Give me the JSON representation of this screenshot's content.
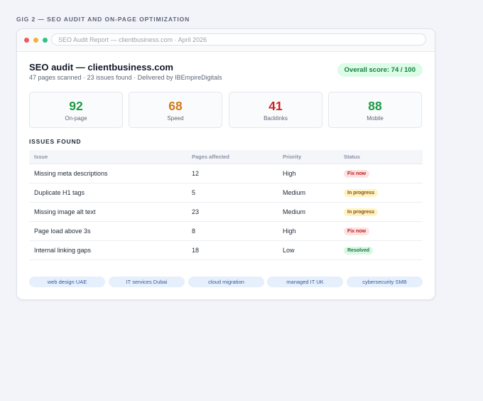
{
  "header": {
    "label": "GIG 2 — SEO AUDIT AND ON-PAGE OPTIMIZATION"
  },
  "window": {
    "url": "SEO Audit Report — clientbusiness.com · April 2026"
  },
  "report": {
    "title": "SEO audit — clientbusiness.com",
    "subtitle": "47 pages scanned · 23 issues found · Delivered by IBEmpireDigitals",
    "overall_score": "Overall score: 74 / 100"
  },
  "metrics": [
    {
      "value": "92",
      "label": "On-page",
      "color": "#1e9a45"
    },
    {
      "value": "68",
      "label": "Speed",
      "color": "#d07a1a"
    },
    {
      "value": "41",
      "label": "Backlinks",
      "color": "#cc1f1f"
    },
    {
      "value": "88",
      "label": "Mobile",
      "color": "#1e9a45"
    }
  ],
  "issues": {
    "section_title": "ISSUES FOUND",
    "columns": [
      "Issue",
      "Pages affected",
      "Priority",
      "Status"
    ],
    "rows": [
      {
        "issue": "Missing meta descriptions",
        "pages": "12",
        "priority": "High",
        "status": "Fix now"
      },
      {
        "issue": "Duplicate H1 tags",
        "pages": "5",
        "priority": "Medium",
        "status": "In progress"
      },
      {
        "issue": "Missing image alt text",
        "pages": "23",
        "priority": "Medium",
        "status": "In progress"
      },
      {
        "issue": "Page load above 3s",
        "pages": "8",
        "priority": "High",
        "status": "Fix now"
      },
      {
        "issue": "Internal linking gaps",
        "pages": "18",
        "priority": "Low",
        "status": "Resolved"
      }
    ]
  },
  "tags": [
    "web design UAE",
    "IT services Dubai",
    "cloud migration",
    "managed IT UK",
    "cybersecurity SMB"
  ]
}
